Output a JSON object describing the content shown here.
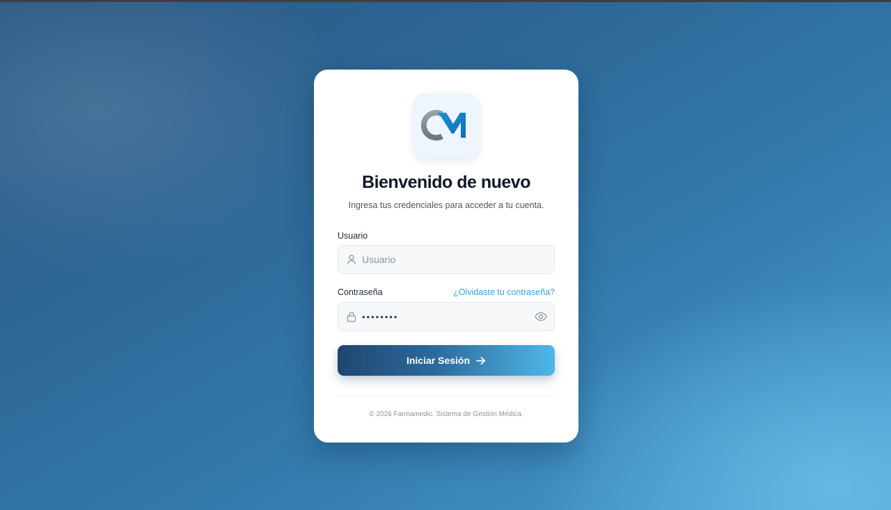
{
  "logo": {
    "text": "CM",
    "name": "cm-logo"
  },
  "login": {
    "title": "Bienvenido de nuevo",
    "subtitle": "Ingresa tus credenciales para acceder a tu cuenta.",
    "username": {
      "label": "Usuario",
      "placeholder": "Usuario",
      "value": "",
      "icon": "user-icon"
    },
    "password": {
      "label": "Contraseña",
      "value": "12345678",
      "forgot_label": "¿Olvidaste tu contraseña?",
      "icon": "lock-icon",
      "toggle_icon": "eye-icon"
    },
    "submit": {
      "label": "Iniciar Sesión",
      "icon": "arrow-right-icon"
    },
    "footer": "© 2026 Farmamedic. Sistema de Gestión Médica."
  },
  "colors": {
    "accent": "#38a2d9",
    "button_start": "#1f4670",
    "button_end": "#4fb7e8",
    "title": "#111827"
  }
}
